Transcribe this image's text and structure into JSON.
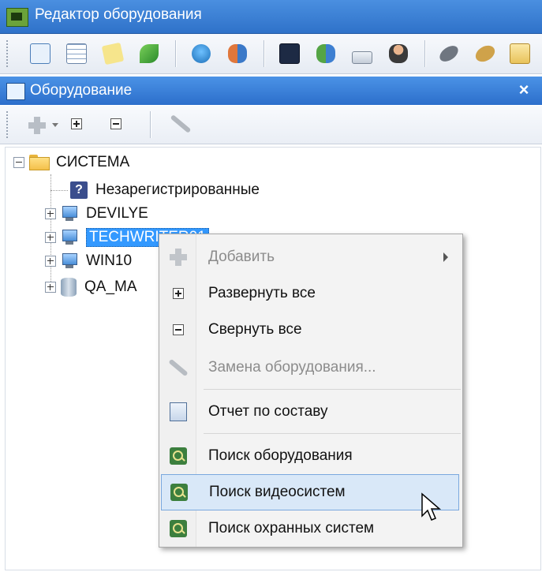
{
  "window": {
    "title": "Редактор оборудования"
  },
  "main_toolbar": {
    "icons": [
      "tree-view-icon",
      "grid-icon",
      "note-icon",
      "tree-green-icon",
      "globe-user-icon",
      "users-icon",
      "terminal-icon",
      "people-icon",
      "drive-icon",
      "person-icon",
      "mouse-icon",
      "card-icon"
    ]
  },
  "panel": {
    "title": "Оборудование",
    "close": "×"
  },
  "tree": {
    "root": "СИСТЕМА",
    "items": [
      {
        "label": "Незарегистрированные",
        "icon": "question-icon"
      },
      {
        "label": "DEVILYE",
        "icon": "computer-icon"
      },
      {
        "label": "TECHWRITER01",
        "icon": "computer-icon"
      },
      {
        "label": "WIN10",
        "icon": "computer-icon"
      },
      {
        "label": "QA_MA",
        "icon": "database-icon"
      }
    ]
  },
  "context_menu": {
    "items": [
      {
        "label": "Добавить",
        "disabled": true
      },
      {
        "label": "Развернуть все"
      },
      {
        "label": "Свернуть все"
      },
      {
        "label": "Замена оборудования...",
        "disabled": true
      },
      {
        "label": "Отчет по составу"
      },
      {
        "label": "Поиск оборудования"
      },
      {
        "label": "Поиск видеосистем",
        "hover": true
      },
      {
        "label": "Поиск охранных систем"
      }
    ]
  },
  "colors": {
    "title_bar": "#2f72c9",
    "selection": "#3399ff",
    "menu_hover": "#d9e8f8"
  }
}
